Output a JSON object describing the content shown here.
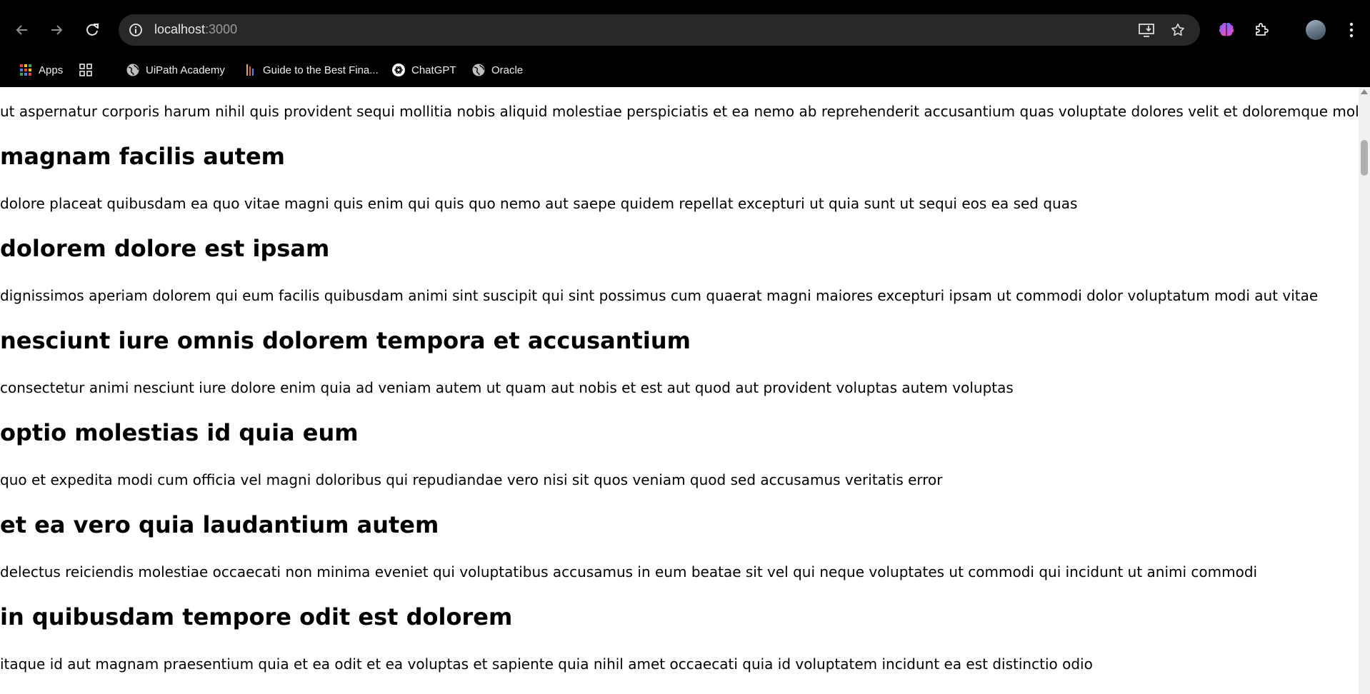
{
  "browser": {
    "url_host": "localhost",
    "url_port": ":3000",
    "bookmarks": [
      "Apps",
      "UiPath Academy",
      "Guide to the Best Fina...",
      "ChatGPT",
      "Oracle"
    ]
  },
  "page": {
    "intro": "ut aspernatur corporis harum nihil quis provident sequi mollitia nobis aliquid molestiae perspiciatis et ea nemo ab reprehenderit accusantium quas voluptate dolores velit et doloremque molestiae",
    "posts": [
      {
        "title": "magnam facilis autem",
        "body": "dolore placeat quibusdam ea quo vitae magni quis enim qui quis quo nemo aut saepe quidem repellat excepturi ut quia sunt ut sequi eos ea sed quas"
      },
      {
        "title": "dolorem dolore est ipsam",
        "body": "dignissimos aperiam dolorem qui eum facilis quibusdam animi sint suscipit qui sint possimus cum quaerat magni maiores excepturi ipsam ut commodi dolor voluptatum modi aut vitae"
      },
      {
        "title": "nesciunt iure omnis dolorem tempora et accusantium",
        "body": "consectetur animi nesciunt iure dolore enim quia ad veniam autem ut quam aut nobis et est aut quod aut provident voluptas autem voluptas"
      },
      {
        "title": "optio molestias id quia eum",
        "body": "quo et expedita modi cum officia vel magni doloribus qui repudiandae vero nisi sit quos veniam quod sed accusamus veritatis error"
      },
      {
        "title": "et ea vero quia laudantium autem",
        "body": "delectus reiciendis molestiae occaecati non minima eveniet qui voluptatibus accusamus in eum beatae sit vel qui neque voluptates ut commodi qui incidunt ut animi commodi"
      },
      {
        "title": "in quibusdam tempore odit est dolorem",
        "body": "itaque id aut magnam praesentium quia et ea odit et ea voluptas et sapiente quia nihil amet occaecati quia id voluptatem incidunt ea est distinctio odio"
      }
    ]
  }
}
